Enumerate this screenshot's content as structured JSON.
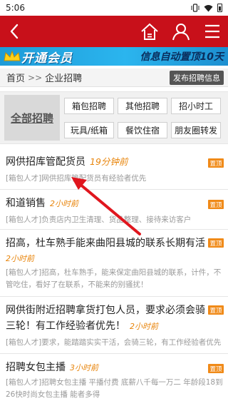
{
  "status_bar": {
    "time": "5:06",
    "vibrate_icon": "vibrate-icon",
    "wifi_icon": "wifi-icon",
    "battery_icon": "battery-icon"
  },
  "app_bar": {
    "color": "#c8101a",
    "back_icon": "back-icon",
    "home_icon": "home-icon",
    "user_icon": "user-icon",
    "menu_icon": "menu-icon"
  },
  "banner": {
    "left_text": "开通会员",
    "right_text": "信息自动置顶10天"
  },
  "breadcrumb": {
    "home": "首页",
    "separator": ">>",
    "current": "企业招聘",
    "post_button": "发布招聘信息"
  },
  "categories": {
    "all_label": "全部招聘",
    "items": [
      "箱包招聘",
      "其他招聘",
      "招小时工",
      "玩具/纸箱",
      "餐饮住宿",
      "朋友圈转发"
    ]
  },
  "jobs": [
    {
      "title": "网供招库管配货员",
      "time": "19分钟前",
      "desc": "[箱包人才]网供招库管配货员有经验者优先",
      "badge": "置顶"
    },
    {
      "title": "和道销售",
      "time": "2小时前",
      "desc": "[箱包人才]负责店内卫生清理、货品整理、接待来访客户",
      "badge": "置顶"
    },
    {
      "title": "招高，杜车熟手能来曲阳县城的联系长期有活",
      "time": "2小时前",
      "desc": "[箱包人才]招高，杜车熟手，能来保定曲阳县城的联系，计件，不管吃住，看好了在联系，不能来的别骚扰！",
      "badge": "置顶"
    },
    {
      "title": "网供街附近招聘拿货打包人员，要求必须会骑三轮！有工作经验者优先！",
      "time": "2小时前",
      "desc": "[箱包人才]要求，能踏踏实实干活，会骑三轮，有工作经验者优先",
      "badge": "置顶"
    },
    {
      "title": "招聘女包主播",
      "time": "3小时前",
      "desc": "[箱包人才]招聘女包主播 平播付费 底薪八千每一万二 年龄段18到26快时尚女包主播 能者多得",
      "badge": "置顶"
    }
  ]
}
